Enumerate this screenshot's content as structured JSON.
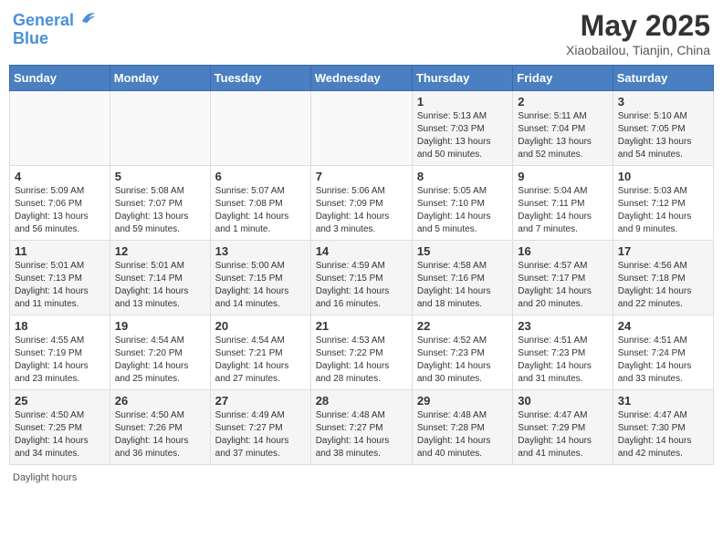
{
  "header": {
    "logo_line1": "General",
    "logo_line2": "Blue",
    "title": "May 2025",
    "subtitle": "Xiaobailou, Tianjin, China"
  },
  "weekdays": [
    "Sunday",
    "Monday",
    "Tuesday",
    "Wednesday",
    "Thursday",
    "Friday",
    "Saturday"
  ],
  "footer": "Daylight hours",
  "weeks": [
    [
      {
        "day": "",
        "info": ""
      },
      {
        "day": "",
        "info": ""
      },
      {
        "day": "",
        "info": ""
      },
      {
        "day": "",
        "info": ""
      },
      {
        "day": "1",
        "info": "Sunrise: 5:13 AM\nSunset: 7:03 PM\nDaylight: 13 hours\nand 50 minutes."
      },
      {
        "day": "2",
        "info": "Sunrise: 5:11 AM\nSunset: 7:04 PM\nDaylight: 13 hours\nand 52 minutes."
      },
      {
        "day": "3",
        "info": "Sunrise: 5:10 AM\nSunset: 7:05 PM\nDaylight: 13 hours\nand 54 minutes."
      }
    ],
    [
      {
        "day": "4",
        "info": "Sunrise: 5:09 AM\nSunset: 7:06 PM\nDaylight: 13 hours\nand 56 minutes."
      },
      {
        "day": "5",
        "info": "Sunrise: 5:08 AM\nSunset: 7:07 PM\nDaylight: 13 hours\nand 59 minutes."
      },
      {
        "day": "6",
        "info": "Sunrise: 5:07 AM\nSunset: 7:08 PM\nDaylight: 14 hours\nand 1 minute."
      },
      {
        "day": "7",
        "info": "Sunrise: 5:06 AM\nSunset: 7:09 PM\nDaylight: 14 hours\nand 3 minutes."
      },
      {
        "day": "8",
        "info": "Sunrise: 5:05 AM\nSunset: 7:10 PM\nDaylight: 14 hours\nand 5 minutes."
      },
      {
        "day": "9",
        "info": "Sunrise: 5:04 AM\nSunset: 7:11 PM\nDaylight: 14 hours\nand 7 minutes."
      },
      {
        "day": "10",
        "info": "Sunrise: 5:03 AM\nSunset: 7:12 PM\nDaylight: 14 hours\nand 9 minutes."
      }
    ],
    [
      {
        "day": "11",
        "info": "Sunrise: 5:01 AM\nSunset: 7:13 PM\nDaylight: 14 hours\nand 11 minutes."
      },
      {
        "day": "12",
        "info": "Sunrise: 5:01 AM\nSunset: 7:14 PM\nDaylight: 14 hours\nand 13 minutes."
      },
      {
        "day": "13",
        "info": "Sunrise: 5:00 AM\nSunset: 7:15 PM\nDaylight: 14 hours\nand 14 minutes."
      },
      {
        "day": "14",
        "info": "Sunrise: 4:59 AM\nSunset: 7:15 PM\nDaylight: 14 hours\nand 16 minutes."
      },
      {
        "day": "15",
        "info": "Sunrise: 4:58 AM\nSunset: 7:16 PM\nDaylight: 14 hours\nand 18 minutes."
      },
      {
        "day": "16",
        "info": "Sunrise: 4:57 AM\nSunset: 7:17 PM\nDaylight: 14 hours\nand 20 minutes."
      },
      {
        "day": "17",
        "info": "Sunrise: 4:56 AM\nSunset: 7:18 PM\nDaylight: 14 hours\nand 22 minutes."
      }
    ],
    [
      {
        "day": "18",
        "info": "Sunrise: 4:55 AM\nSunset: 7:19 PM\nDaylight: 14 hours\nand 23 minutes."
      },
      {
        "day": "19",
        "info": "Sunrise: 4:54 AM\nSunset: 7:20 PM\nDaylight: 14 hours\nand 25 minutes."
      },
      {
        "day": "20",
        "info": "Sunrise: 4:54 AM\nSunset: 7:21 PM\nDaylight: 14 hours\nand 27 minutes."
      },
      {
        "day": "21",
        "info": "Sunrise: 4:53 AM\nSunset: 7:22 PM\nDaylight: 14 hours\nand 28 minutes."
      },
      {
        "day": "22",
        "info": "Sunrise: 4:52 AM\nSunset: 7:23 PM\nDaylight: 14 hours\nand 30 minutes."
      },
      {
        "day": "23",
        "info": "Sunrise: 4:51 AM\nSunset: 7:23 PM\nDaylight: 14 hours\nand 31 minutes."
      },
      {
        "day": "24",
        "info": "Sunrise: 4:51 AM\nSunset: 7:24 PM\nDaylight: 14 hours\nand 33 minutes."
      }
    ],
    [
      {
        "day": "25",
        "info": "Sunrise: 4:50 AM\nSunset: 7:25 PM\nDaylight: 14 hours\nand 34 minutes."
      },
      {
        "day": "26",
        "info": "Sunrise: 4:50 AM\nSunset: 7:26 PM\nDaylight: 14 hours\nand 36 minutes."
      },
      {
        "day": "27",
        "info": "Sunrise: 4:49 AM\nSunset: 7:27 PM\nDaylight: 14 hours\nand 37 minutes."
      },
      {
        "day": "28",
        "info": "Sunrise: 4:48 AM\nSunset: 7:27 PM\nDaylight: 14 hours\nand 38 minutes."
      },
      {
        "day": "29",
        "info": "Sunrise: 4:48 AM\nSunset: 7:28 PM\nDaylight: 14 hours\nand 40 minutes."
      },
      {
        "day": "30",
        "info": "Sunrise: 4:47 AM\nSunset: 7:29 PM\nDaylight: 14 hours\nand 41 minutes."
      },
      {
        "day": "31",
        "info": "Sunrise: 4:47 AM\nSunset: 7:30 PM\nDaylight: 14 hours\nand 42 minutes."
      }
    ]
  ]
}
